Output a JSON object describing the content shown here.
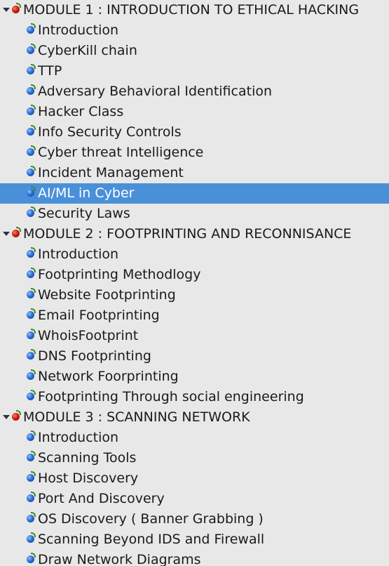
{
  "modules": [
    {
      "title": "MODULE 1 : INTRODUCTION TO ETHICAL HACKING",
      "items": [
        "Introduction",
        "CyberKill chain",
        "TTP",
        "Adversary Behavioral Identification",
        "Hacker Class",
        "Info Security Controls",
        "Cyber threat Intelligence",
        "Incident Management",
        "AI/ML in Cyber",
        "Security Laws"
      ]
    },
    {
      "title": "MODULE 2 : FOOTPRINTING AND RECONNISANCE",
      "items": [
        "Introduction",
        "Footprinting Methodlogy",
        "Website Footprinting",
        "Email Footprinting",
        "WhoisFootprint",
        "DNS Footprinting",
        "Network Foorprinting",
        "Footprinting Through social engineering"
      ]
    },
    {
      "title": "MODULE 3 : SCANNING NETWORK",
      "items": [
        "Introduction",
        "Scanning Tools",
        "Host Discovery",
        "Port And Discovery",
        "OS Discovery ( Banner Grabbing )",
        "Scanning Beyond IDS and Firewall",
        "Draw Network Diagrams"
      ]
    }
  ],
  "selected": "AI/ML in Cyber",
  "colors": {
    "selection": "#4a90d9",
    "background": "#e8e8e8",
    "module_bullet": "red",
    "item_bullet": "blue"
  },
  "icons": {
    "expander": "triangle-down-icon",
    "module_bullet": "red-ball-icon",
    "item_bullet": "blue-ball-icon"
  }
}
